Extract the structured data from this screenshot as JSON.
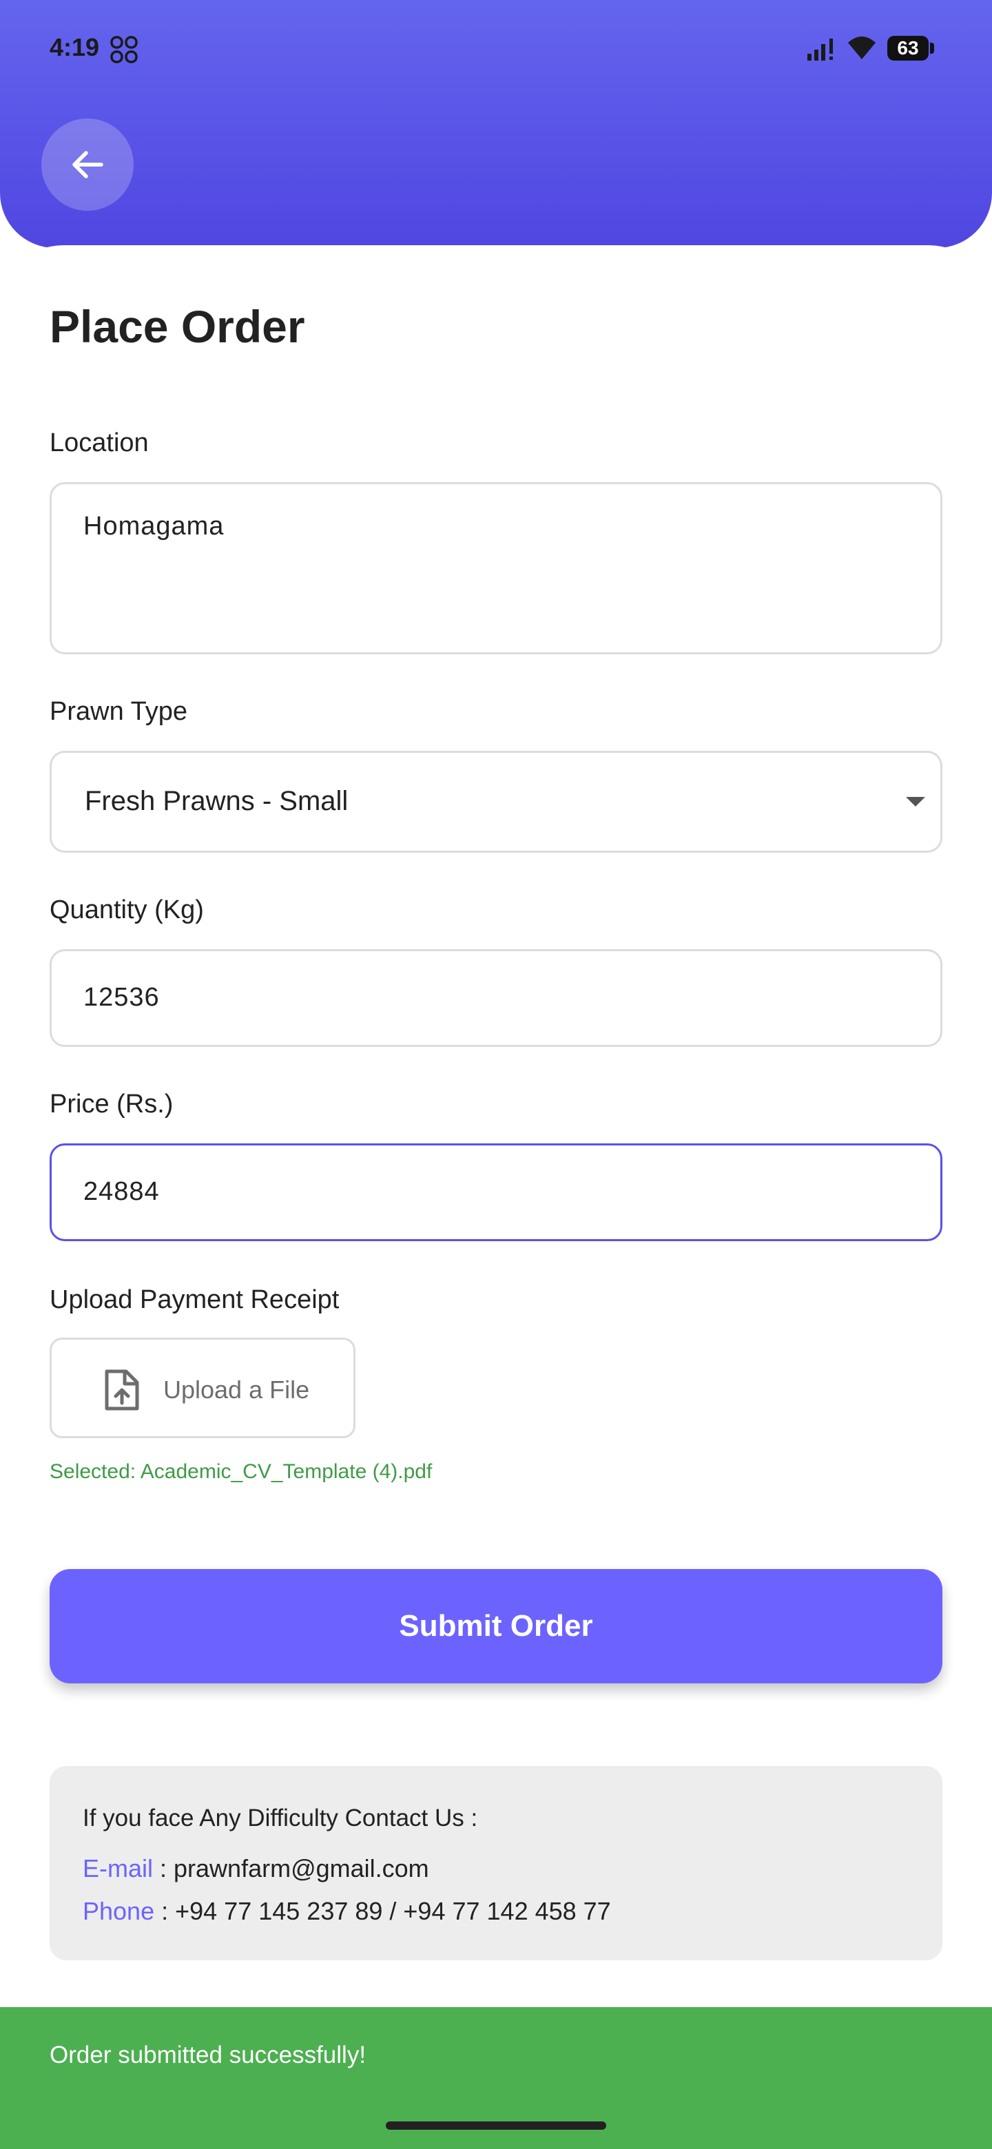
{
  "status_bar": {
    "time": "4:19",
    "battery": "63",
    "icons": [
      "app-icon",
      "signal-icon",
      "wifi-icon",
      "battery-icon"
    ]
  },
  "header": {
    "back_icon": "arrow-left-icon",
    "colors": {
      "gradient_top": "#6465ee",
      "gradient_bottom": "#5046e1"
    }
  },
  "form": {
    "title": "Place Order",
    "location_label": "Location",
    "location_value": "Homagama",
    "prawn_type_label": "Prawn Type",
    "prawn_type_value": "Fresh Prawns - Small",
    "quantity_label": "Quantity (Kg)",
    "quantity_value": "12536",
    "price_label": "Price (Rs.)",
    "price_value": "24884",
    "upload_label": "Upload Payment Receipt",
    "upload_button": "Upload a File",
    "selected_file": "Selected: Academic_CV_Template (4).pdf",
    "submit_button": "Submit Order"
  },
  "contact": {
    "title": "If you face Any Difficulty Contact Us :",
    "email_key": "E-mail",
    "email_value": " : prawnfarm@gmail.com",
    "phone_key": "Phone",
    "phone_value": " : +94 77 145 237 89 / +94 77 142 458 77"
  },
  "toast": {
    "message": "Order submitted successfully!"
  },
  "colors": {
    "accent": "#6c63ff",
    "success": "#4caf50",
    "focused_border": "#5a51e8"
  }
}
